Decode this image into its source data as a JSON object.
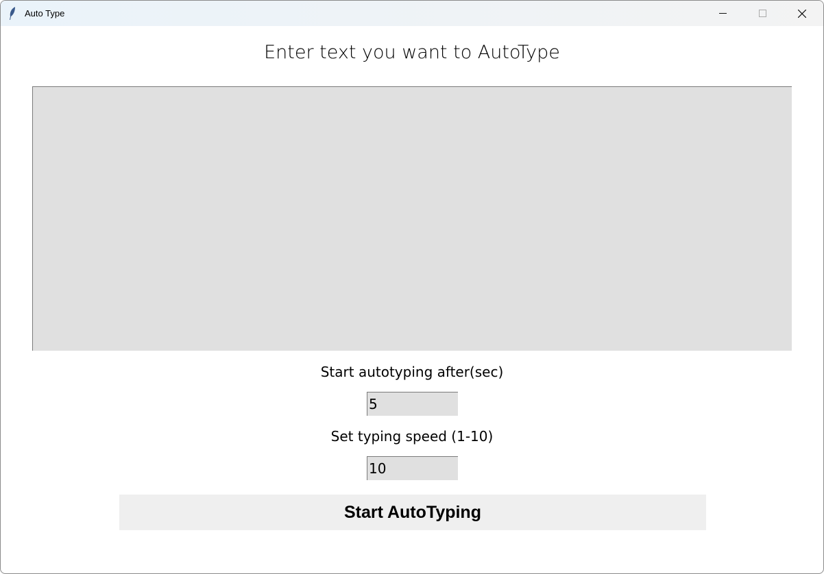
{
  "window": {
    "title": "Auto Type",
    "icon": "feather-icon",
    "controls": [
      "minimize",
      "maximize",
      "close"
    ]
  },
  "main": {
    "heading": "Enter text you want to AutoType",
    "text_input": {
      "value": ""
    },
    "delay": {
      "label": "Start autotyping after(sec)",
      "value": "5"
    },
    "speed": {
      "label": "Set typing speed (1-10)",
      "value": "10"
    },
    "start_button": "Start AutoTyping"
  }
}
